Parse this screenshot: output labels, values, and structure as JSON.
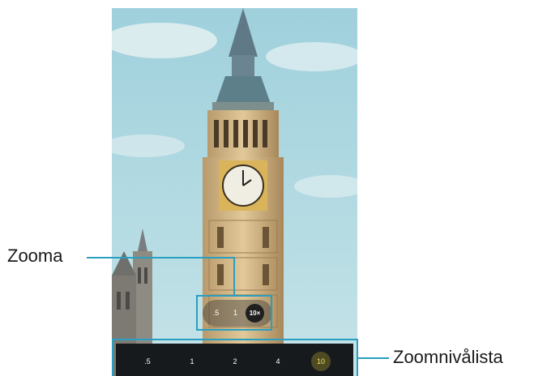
{
  "callouts": {
    "zoom_label": "Zooma",
    "zoom_levels_label": "Zoomnivålista"
  },
  "quick_zoom": {
    "options": [
      ".5",
      "1",
      "10×"
    ],
    "selected": "10×"
  },
  "zoom_levels": {
    "options": [
      ".5",
      "1",
      "2",
      "4",
      "10"
    ],
    "selected": "10"
  },
  "colors": {
    "highlight": "#2a9ec0",
    "active_level_text": "#f3e15b",
    "bar_background": "#161a1d"
  }
}
